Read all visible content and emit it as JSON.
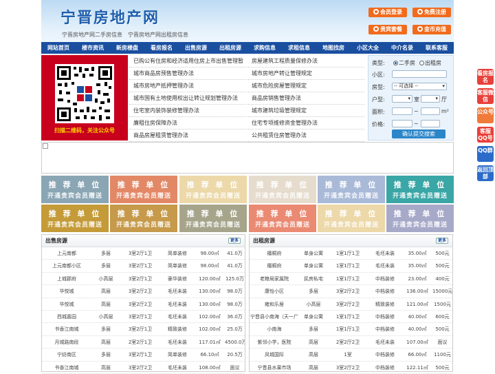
{
  "header": {
    "logo": "宁晋房地产网",
    "sublinks": [
      "宁晋房地产网二手房信息",
      "宁晋房地产网出租房信息"
    ],
    "buttons": [
      {
        "label": "会员登录",
        "icon": "user-icon"
      },
      {
        "label": "免费注册",
        "icon": "register-icon"
      },
      {
        "label": "贵宾套餐",
        "icon": "vip-icon"
      },
      {
        "label": "金币充值",
        "icon": "coin-icon"
      }
    ],
    "accent": "#f26b1d"
  },
  "nav": [
    "网站首页",
    "楼市资讯",
    "新房楼盘",
    "看房报名",
    "出售房源",
    "出租房源",
    "求购信息",
    "求租信息",
    "地图找房",
    "小区大全",
    "中介名录",
    "联系客服"
  ],
  "qr": {
    "caption": "扫描二维码，关注公众号"
  },
  "news": {
    "left": [
      "已购公有住房和经济适用住房上市出售管理暂",
      "城市商品房预售管理办法",
      "城市房地产抵押管理办法",
      "城市国有土地使用权出让转让规划管理办法",
      "住宅室内装饰装修管理办法",
      "廉租住房保障办法",
      "商品房屋租赁管理办法"
    ],
    "right": [
      "房屋建筑工程质量保修办法",
      "城市房地产转让管理规定",
      "城市危险房屋管理规定",
      "商品房销售管理办法",
      "城市建筑垃圾管理规定",
      "住宅专项维修资金管理办法",
      "公共租赁住房管理办法"
    ]
  },
  "search": {
    "type_label": "类型:",
    "type_options": [
      "二手房",
      "出租房"
    ],
    "community_label": "小区:",
    "housetype_label": "房型:",
    "housetype_value": "-- 可选择 --",
    "layout_label": "户型:",
    "room_unit": "室",
    "hall_unit": "厅",
    "area_label": "面积:",
    "area_unit": "m²",
    "price_label": "价格:",
    "range_sep": "~",
    "submit": "确认提交搜索"
  },
  "ads": {
    "line1": "推 荐 单 位",
    "line2": "开通贵宾会员赠送",
    "colors": [
      "#8aa6b4",
      "#e38866",
      "#ecd8a8",
      "#e6dccd",
      "#a9b9d8",
      "#3aa6a6",
      "#c49b38",
      "#c69a4a",
      "#a6a58c",
      "#ea8a72",
      "#ecd8a8",
      "#a7a9c9"
    ]
  },
  "sale": {
    "title": "出售房源",
    "more": "更多",
    "rows": [
      [
        "上元南都",
        "多层",
        "3室2厅1卫",
        "简单装修",
        "98.00㎡",
        "41.0万"
      ],
      [
        "上元南都小区",
        "多层",
        "3室2厅1卫",
        "简单装修",
        "98.00㎡",
        "41.0万"
      ],
      [
        "上城郡府",
        "小高层",
        "3室2厅1卫",
        "豪华装修",
        "120.00㎡",
        "125.0万"
      ],
      [
        "华悦城",
        "高层",
        "3室2厅2卫",
        "毛坯未装",
        "130.00㎡",
        "98.0万"
      ],
      [
        "华悦城",
        "高层",
        "3室2厅2卫",
        "毛坯未装",
        "130.00㎡",
        "98.0万"
      ],
      [
        "西城嘉园",
        "小高层",
        "3室2厅1卫",
        "毛坯未装",
        "102.00㎡",
        "36.0万"
      ],
      [
        "书香江南城",
        "多层",
        "3室2厅1卫",
        "精致装修",
        "102.00㎡",
        "25.0万"
      ],
      [
        "月城路南段",
        "高层",
        "2室2厅1卫",
        "毛坯未装",
        "117.01㎡",
        "4500.0万"
      ],
      [
        "宁纺南区",
        "多层",
        "3室2厅1卫",
        "简单装修",
        "66.10㎡",
        "20.5万"
      ],
      [
        "书香江南城",
        "高层",
        "3室2厅2卫",
        "毛坯未装",
        "108.00㎡",
        "面议"
      ]
    ]
  },
  "rent": {
    "title": "出租房源",
    "more": "更多",
    "rows": [
      [
        "檀桐府",
        "单身公寓",
        "1室1厅1卫",
        "毛坯未装",
        "35.00㎡",
        "500元"
      ],
      [
        "檀桐府",
        "单身公寓",
        "1室1厅1卫",
        "毛坯未装",
        "35.00㎡",
        "500元"
      ],
      [
        "老粮局家属院",
        "民房私宅",
        "1室1厅1卫",
        "中档装修",
        "23.00㎡",
        "400元"
      ],
      [
        "康怡小区",
        "多层",
        "3室2厅2卫",
        "中档装修",
        "136.00㎡",
        "15000元"
      ],
      [
        "雍和乐居",
        "小高层",
        "3室2厅2卫",
        "精致装修",
        "121.00㎡",
        "1500元"
      ],
      [
        "宁晋县小南海（天一广",
        "单身公寓",
        "1室1厅1卫",
        "中档装修",
        "40.00㎡",
        "600元"
      ],
      [
        "小南海",
        "多层",
        "1室1厅1卫",
        "中档装修",
        "40.00㎡",
        "500元"
      ],
      [
        "紫邻小学，医院",
        "高层",
        "2室2厅2卫",
        "毛坯未装",
        "107.00㎡",
        "面议"
      ],
      [
        "凤城国际",
        "高层",
        "1室",
        "中档装修",
        "66.00㎡",
        "1100元"
      ],
      [
        "宁晋县水果市场",
        "高层",
        "3室2厅2卫",
        "中档装修",
        "122.11㎡",
        "500元"
      ]
    ]
  },
  "side": [
    {
      "label": "看房报名",
      "color": "#e8403a"
    },
    {
      "label": "客服微信",
      "color": "#e8403a"
    },
    {
      "label": "公众号",
      "color": "#f07a3a"
    },
    {
      "label": "客服QQ号",
      "color": "#e8403a"
    },
    {
      "label": "QQ群",
      "color": "#2b6bc9"
    },
    {
      "label": "返回顶部",
      "color": "#2b6bc9"
    }
  ]
}
